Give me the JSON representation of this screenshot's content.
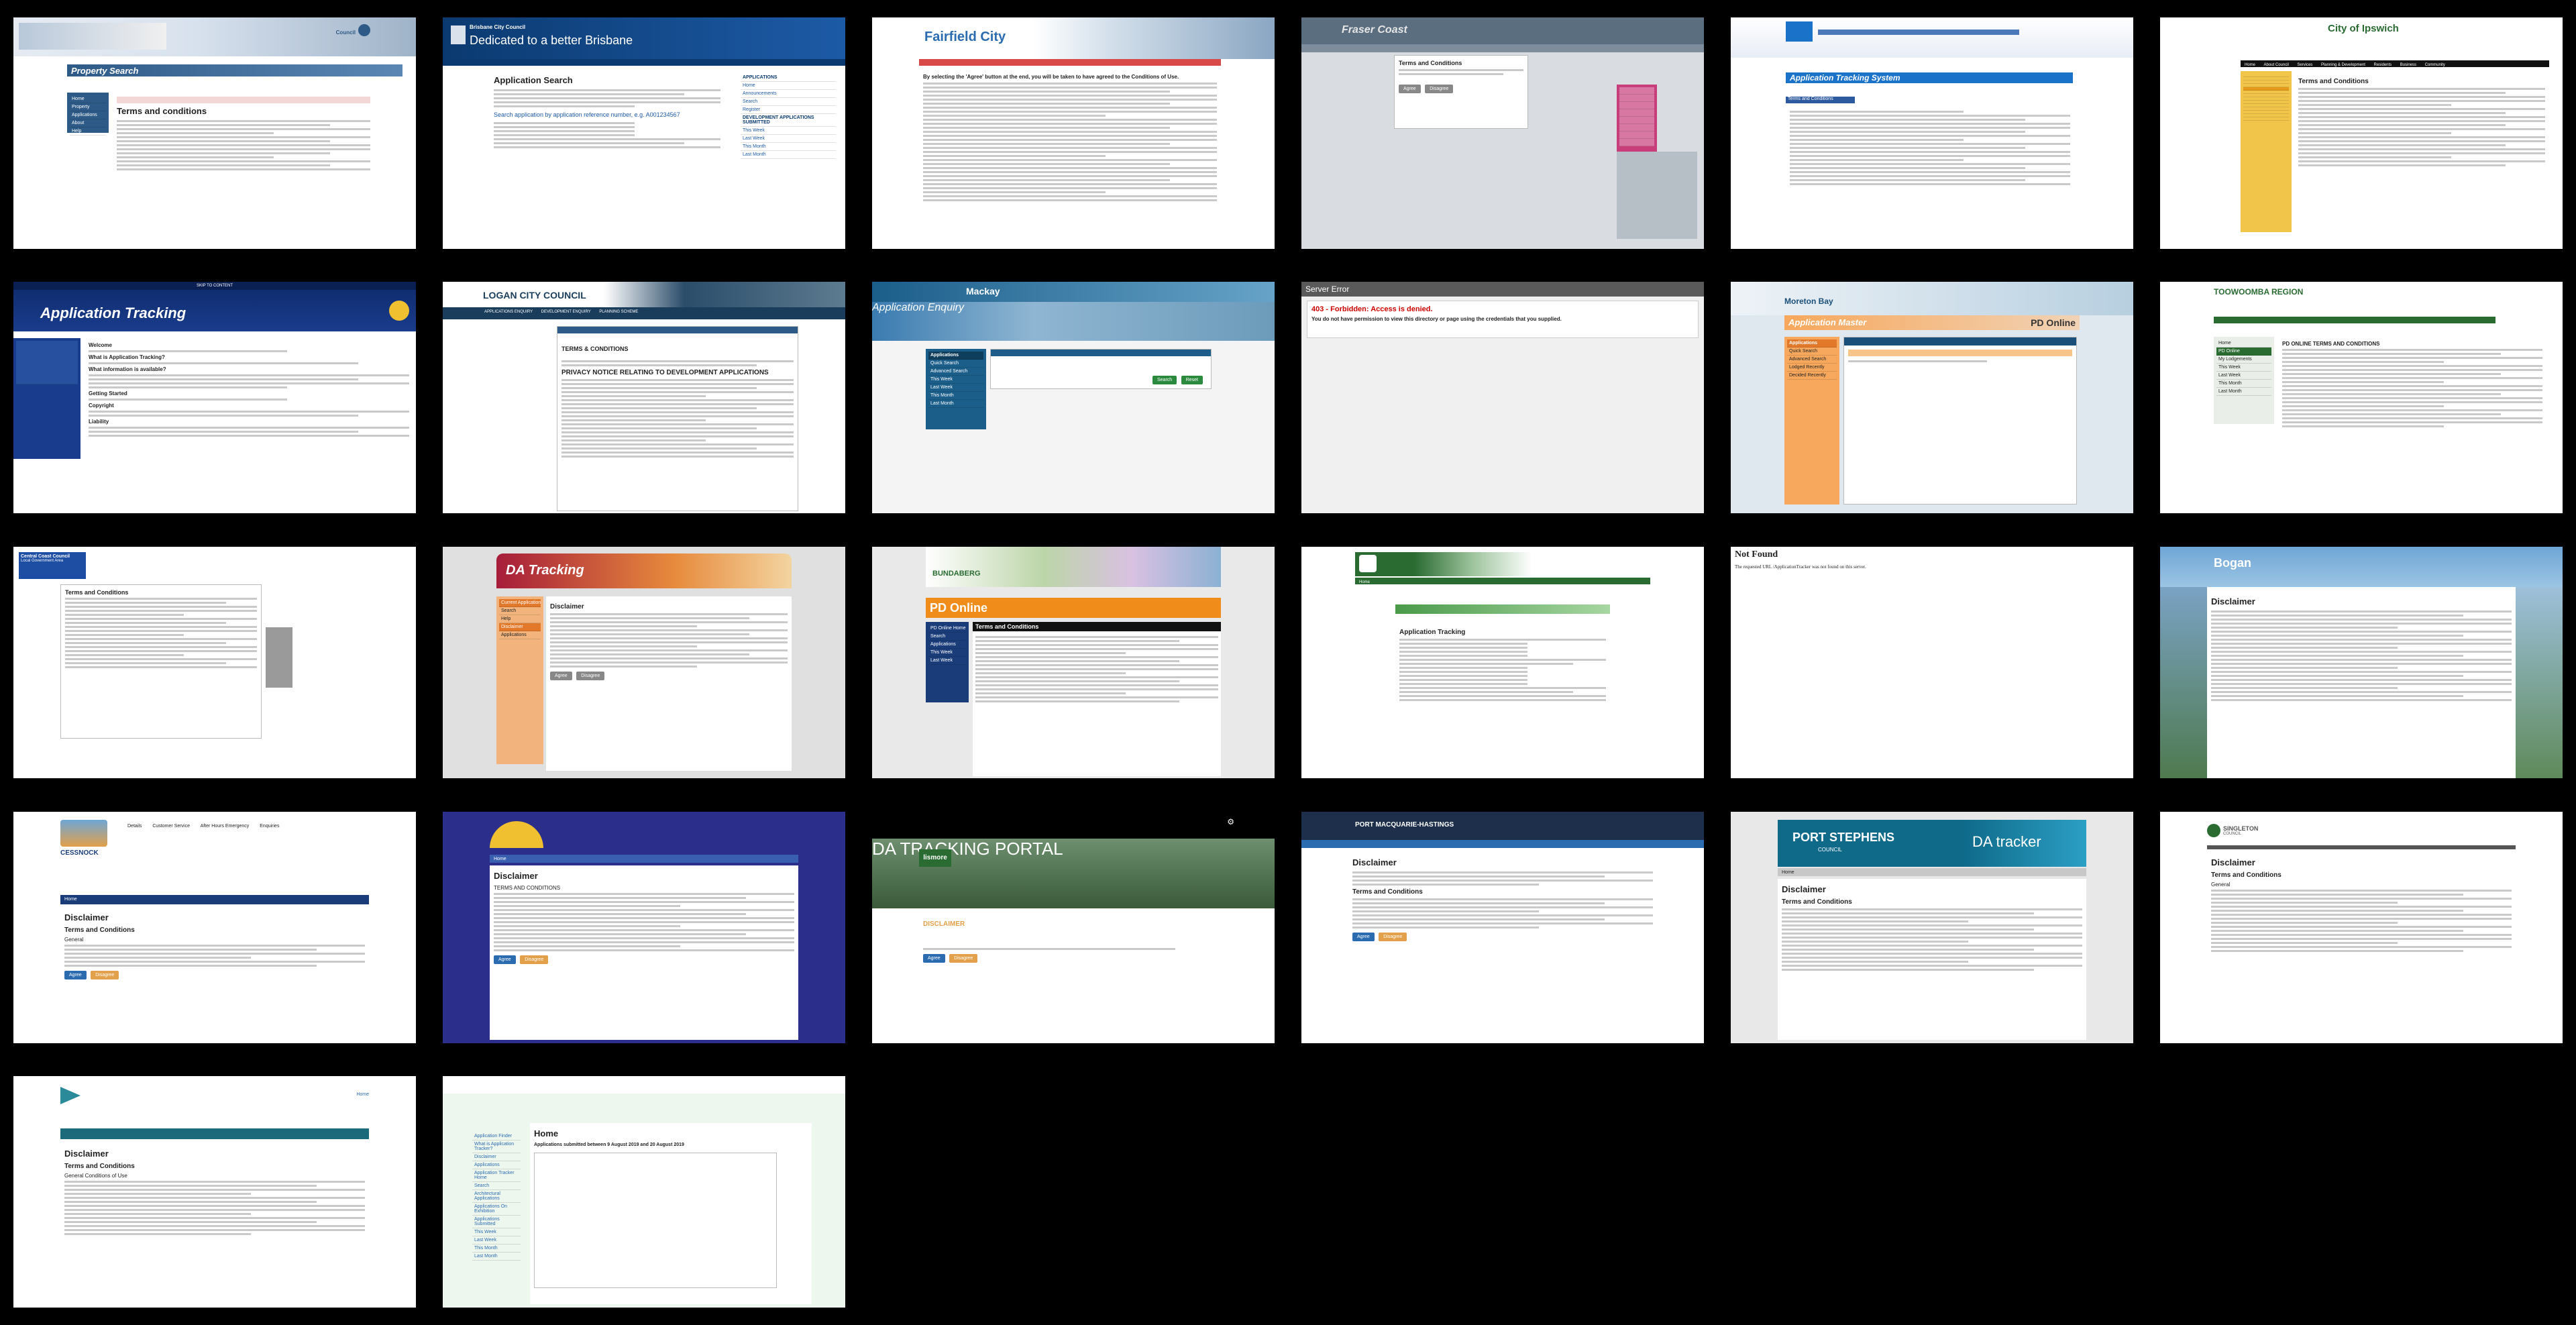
{
  "t1": {
    "title": "Property Search",
    "heading": "Terms and conditions",
    "side": [
      "Home",
      "Property",
      "Applications",
      "About",
      "Help"
    ]
  },
  "t2": {
    "council": "Brisbane City Council",
    "tagline": "Dedicated to a better Brisbane",
    "heading": "Application Search",
    "link": "Search application by application reference number, e.g. A001234567",
    "side": [
      "APPLICATIONS",
      "Home",
      "Announcements",
      "Search",
      "Register",
      "DEVELOPMENT APPLICATIONS SUBMITTED",
      "This Week",
      "Last Week",
      "This Month",
      "Last Month"
    ]
  },
  "t3": {
    "council": "Fairfield City",
    "heading": "By selecting the 'Agree' button at the end, you will be taken to have agreed to the Conditions of Use."
  },
  "t4": {
    "council": "Fraser Coast",
    "heading": "Terms and Conditions",
    "btns": [
      "Agree",
      "Disagree"
    ]
  },
  "t5": {
    "heading": "Application Tracking System",
    "sub": "Terms and Conditions"
  },
  "t6": {
    "council": "City of Ipswich",
    "heading": "Terms and Conditions",
    "nav": [
      "Home",
      "About Council",
      "Services",
      "Planning & Development",
      "Residents",
      "Business",
      "Community"
    ]
  },
  "t7": {
    "heading": "Application Tracking",
    "top": "SKIP TO CONTENT",
    "sections": [
      "Welcome",
      "What is Application Tracking?",
      "What information is available?",
      "Getting Started",
      "Copyright",
      "Liability"
    ]
  },
  "t8": {
    "council": "LOGAN CITY COUNCIL",
    "heading": "TERMS & CONDITIONS",
    "sub": "PRIVACY NOTICE RELATING TO DEVELOPMENT APPLICATIONS",
    "tabs": [
      "APPLICATIONS ENQUIRY",
      "DEVELOPMENT ENQUIRY",
      "PLANNING SCHEME"
    ]
  },
  "t9": {
    "council": "Mackay",
    "heading": "Application Enquiry",
    "side": [
      "Applications",
      "Quick Search",
      "Advanced Search",
      "This Week",
      "Last Week",
      "This Month",
      "Last Month"
    ],
    "btns": [
      "Search",
      "Reset"
    ]
  },
  "t10": {
    "title": "Server Error",
    "heading": "403 - Forbidden: Access is denied.",
    "msg": "You do not have permission to view this directory or page using the credentials that you supplied."
  },
  "t11": {
    "council": "Moreton Bay",
    "heading": "Application Master",
    "right": "PD Online",
    "side": [
      "Applications",
      "Quick Search",
      "Advanced Search",
      "Lodged Recently",
      "Decided Recently"
    ]
  },
  "t12": {
    "council": "TOOWOOMBA REGION",
    "heading": "PD ONLINE TERMS AND CONDITIONS",
    "side": [
      "Home",
      "PD Online",
      "My Lodgements",
      "This Week",
      "Last Week",
      "This Month",
      "Last Month"
    ]
  },
  "t13": {
    "council": "Central Coast Council",
    "sub": "Local Government Area",
    "heading": "Terms and Conditions"
  },
  "t14": {
    "heading": "DA Tracking",
    "side": [
      "Current Applications",
      "Search",
      "Help",
      "Disclaimer",
      "Applications"
    ],
    "sub": "Disclaimer",
    "btns": [
      "Agree",
      "Disagree"
    ]
  },
  "t15": {
    "council": "BUNDABERG",
    "heading": "PD Online",
    "sub": "Terms and Conditions",
    "side": [
      "PD Online Home",
      "Search",
      "Applications",
      "This Week",
      "Last Week"
    ]
  },
  "t16": {
    "heading": "Application Tracking",
    "nav": [
      "Home"
    ]
  },
  "t17": {
    "heading": "Not Found",
    "msg": "The requested URL /ApplicationTracker was not found on this server."
  },
  "t18": {
    "council": "Bogan",
    "heading": "Disclaimer"
  },
  "t19": {
    "council": "CESSNOCK",
    "heading": "Disclaimer",
    "sub": "Terms and Conditions",
    "sub2": "General",
    "nav": "Home",
    "contacts": [
      "Details",
      "Customer Service",
      "After Hours Emergency",
      "Enquiries"
    ],
    "btns": [
      "Agree",
      "Disagree"
    ]
  },
  "t20": {
    "heading": "Disclaimer",
    "sub": "TERMS AND CONDITIONS",
    "nav": "Home",
    "btns": [
      "Agree",
      "Disagree"
    ]
  },
  "t21": {
    "council": "lismore",
    "heading": "DA TRACKING PORTAL",
    "sub": "DISCLAIMER",
    "btns": [
      "Agree",
      "Disagree"
    ]
  },
  "t22": {
    "council": "PORT MACQUARIE-HASTINGS",
    "heading": "Disclaimer",
    "sub": "Terms and Conditions",
    "btns": [
      "Agree",
      "Disagree"
    ]
  },
  "t23": {
    "council": "PORT STEPHENS",
    "sub0": "COUNCIL",
    "tracker": "DA tracker",
    "heading": "Disclaimer",
    "sub": "Terms and Conditions",
    "nav": "Home"
  },
  "t24": {
    "council": "SINGLETON",
    "sub0": "COUNCIL",
    "heading": "Disclaimer",
    "sub": "Terms and Conditions",
    "sub2": "General"
  },
  "t25": {
    "heading": "Disclaimer",
    "sub": "Terms and Conditions",
    "sub2": "General Conditions of Use",
    "nav": "Home"
  },
  "t26": {
    "heading": "Home",
    "sub": "Applications submitted between 9 August 2019 and 20 August 2019",
    "side": [
      "Application Finder",
      "What is Application Tracker?",
      "Disclaimer",
      "Applications",
      "Application Tracker Home",
      "Search",
      "Architectural Applications",
      "Applications On Exhibition",
      "Applications Submitted",
      "This Week",
      "Last Week",
      "This Month",
      "Last Month"
    ]
  }
}
